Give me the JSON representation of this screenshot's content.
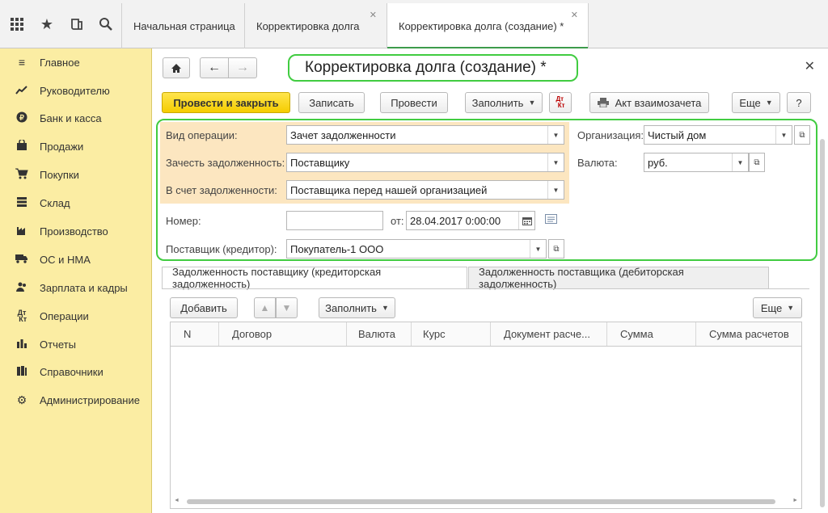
{
  "topbar": {
    "icons": [
      "apps-grid-icon",
      "star-icon",
      "history-icon",
      "search-icon"
    ],
    "tabs": [
      {
        "label": "Начальная страница",
        "closable": false,
        "active": false
      },
      {
        "label": "Корректировка долга",
        "closable": true,
        "active": false
      },
      {
        "label": "Корректировка долга (создание) *",
        "closable": true,
        "active": true
      }
    ]
  },
  "sidebar": {
    "items": [
      {
        "label": "Главное",
        "icon": "menu-lines-icon"
      },
      {
        "label": "Руководителю",
        "icon": "trend-chart-icon"
      },
      {
        "label": "Банк и касса",
        "icon": "ruble-coin-icon"
      },
      {
        "label": "Продажи",
        "icon": "shopping-bag-icon"
      },
      {
        "label": "Покупки",
        "icon": "cart-icon"
      },
      {
        "label": "Склад",
        "icon": "warehouse-icon"
      },
      {
        "label": "Производство",
        "icon": "factory-icon"
      },
      {
        "label": "ОС и НМА",
        "icon": "truck-icon"
      },
      {
        "label": "Зарплата и кадры",
        "icon": "people-icon"
      },
      {
        "label": "Операции",
        "icon": "dt-kt-icon"
      },
      {
        "label": "Отчеты",
        "icon": "bar-chart-icon"
      },
      {
        "label": "Справочники",
        "icon": "books-icon"
      },
      {
        "label": "Администрирование",
        "icon": "gear-icon"
      }
    ]
  },
  "form": {
    "title": "Корректировка долга (создание) *",
    "toolbar": {
      "post_close": "Провести и закрыть",
      "save": "Записать",
      "post": "Провести",
      "fill": "Заполнить",
      "dtkt": "Дт Кт",
      "offset_act": "Акт взаимозачета",
      "more": "Еще",
      "help": "?"
    },
    "fields": {
      "operation_label": "Вид операции:",
      "operation_value": "Зачет задолженности",
      "offset_label": "Зачесть задолженность:",
      "offset_value": "Поставщику",
      "against_label": "В счет задолженности:",
      "against_value": "Поставщика перед нашей организацией",
      "number_label": "Номер:",
      "number_value": "",
      "date_label": "от:",
      "date_value": "28.04.2017  0:00:00",
      "supplier_label": "Поставщик (кредитор):",
      "supplier_value": "Покупатель-1 ООО",
      "org_label": "Организация:",
      "org_value": "Чистый дом",
      "currency_label": "Валюта:",
      "currency_value": "руб."
    },
    "tabs": [
      {
        "label": "Задолженность поставщику (кредиторская задолженность)",
        "active": true
      },
      {
        "label": "Задолженность поставщика (дебиторская задолженность)",
        "active": false
      }
    ],
    "table_toolbar": {
      "add": "Добавить",
      "fill": "Заполнить",
      "more": "Еще"
    },
    "table": {
      "columns": [
        "N",
        "Договор",
        "Валюта",
        "Курс",
        "Документ расче...",
        "Сумма",
        "Сумма расчетов"
      ],
      "rows": []
    }
  }
}
